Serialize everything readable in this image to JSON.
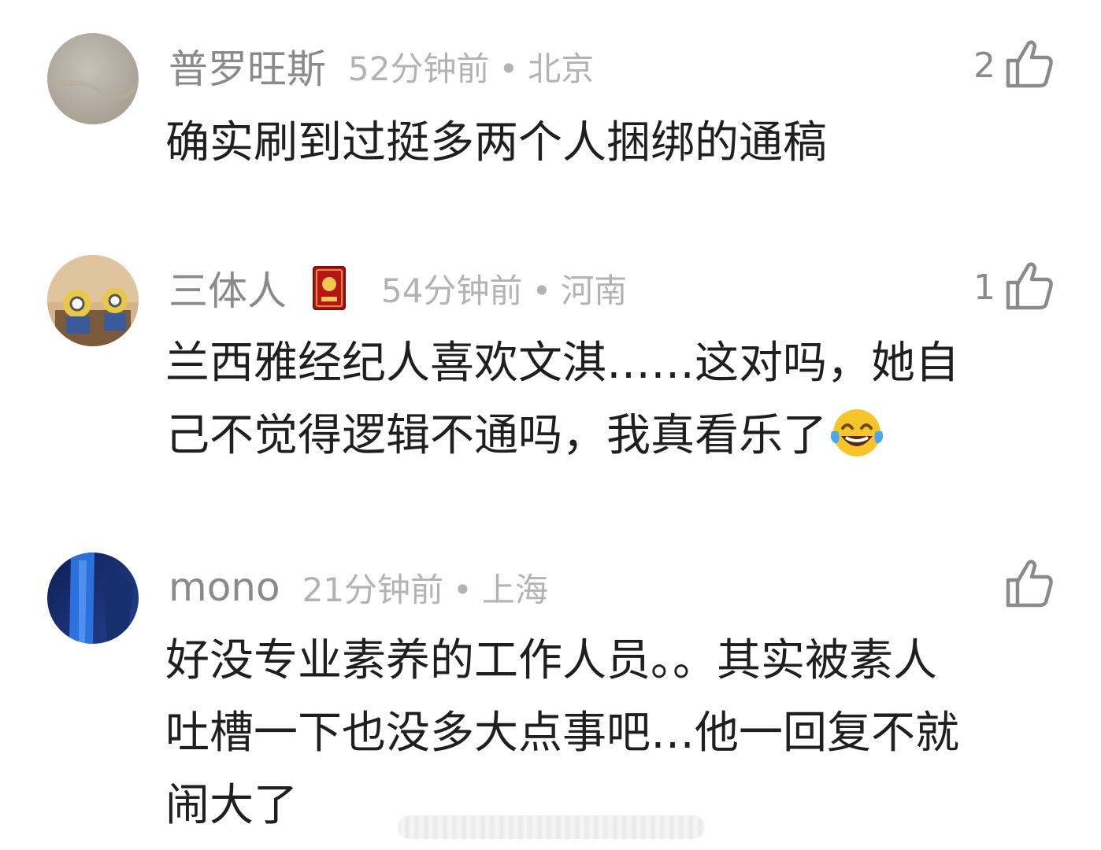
{
  "comments": [
    {
      "username": "普罗旺斯",
      "time": "52分钟前",
      "separator": "•",
      "location": "北京",
      "likes": "2",
      "text": "确实刷到过挺多两个人捆绑的通稿",
      "avatar_color": "#b8b0a4"
    },
    {
      "username": "三体人",
      "time": "54分钟前",
      "separator": "•",
      "location": "河南",
      "likes": "1",
      "text_line1": "兰西雅经纪人喜欢文淇……这对吗，她自",
      "text_line2": "己不觉得逻辑不通吗，我真看乐了",
      "emoji": "laughing-with-tears",
      "avatar_color": "#c9a782"
    },
    {
      "username": "mono",
      "time": "21分钟前",
      "separator": "•",
      "location": "上海",
      "likes": "",
      "text_line1": "好没专业素养的工作人员。。其实被素人",
      "text_line2": "吐槽一下也没多大点事吧…他一回复不就",
      "text_line3": "闹大了",
      "avatar_color": "#1b3a8a"
    }
  ],
  "colors": {
    "meta_gray": "#8a8a8a",
    "light_gray": "#b3b3b3",
    "text": "#1f1f1f"
  },
  "icons": {
    "like": "thumbs-up-icon",
    "badge": "red-card-badge-icon"
  }
}
